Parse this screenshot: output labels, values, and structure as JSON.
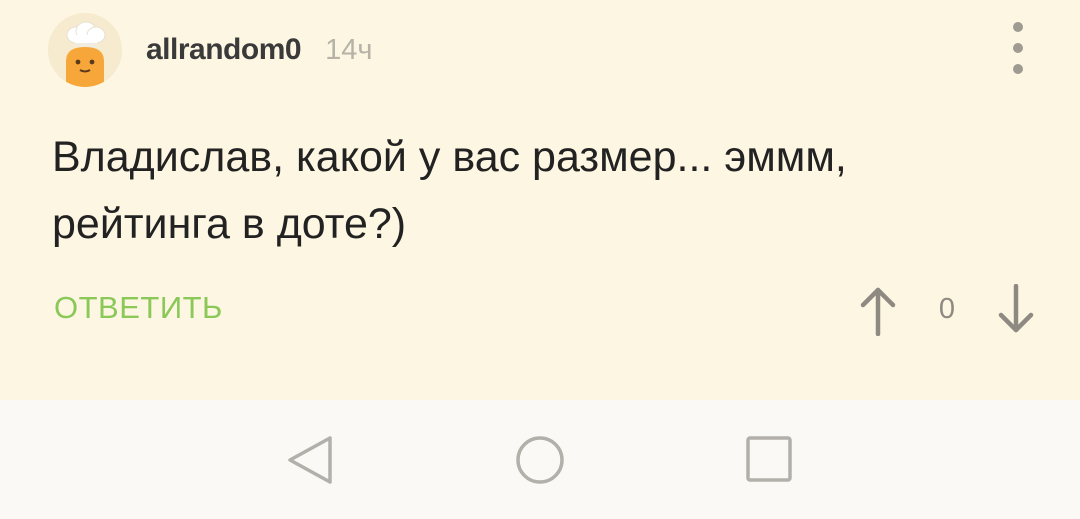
{
  "comment": {
    "username": "allrandom0",
    "time": "14ч",
    "text": "Владислав, какой у вас размер... эммм, рейтинга в доте?)",
    "reply_label": "ОТВЕТИТЬ",
    "score": "0",
    "colors": {
      "card_background": "#fdf6e2",
      "reply": "#8ac858",
      "muted": "#9f9b93"
    },
    "icons": {
      "avatar": "chef-avatar",
      "menu": "kebab-menu-icon",
      "upvote": "arrow-up-icon",
      "downvote": "arrow-down-icon"
    }
  },
  "nav_bar": {
    "icons": [
      "back-triangle-icon",
      "home-circle-icon",
      "recent-apps-square-icon"
    ]
  }
}
